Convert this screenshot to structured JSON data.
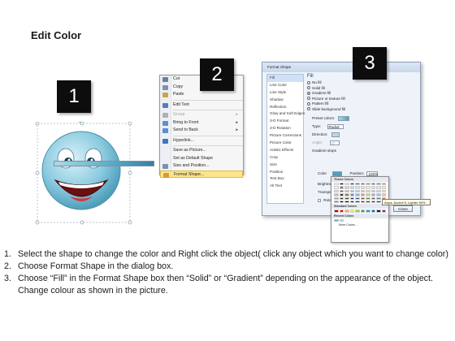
{
  "title": "Edit Color",
  "badges": [
    "1",
    "2",
    "3"
  ],
  "context_menu": {
    "items": [
      {
        "label": "Cut",
        "icon": "scissors-icon",
        "color": "#6a7fa6",
        "disabled": false
      },
      {
        "label": "Copy",
        "icon": "copy-icon",
        "color": "#7e8fb0",
        "disabled": false
      },
      {
        "label": "Paste",
        "icon": "paste-icon",
        "color": "#c9a44a",
        "disabled": false
      },
      {
        "label": "Edit Text",
        "icon": "edit-text-icon",
        "color": "#5b7bb4",
        "disabled": false,
        "sep_before": true
      },
      {
        "label": "Group",
        "icon": "group-icon",
        "color": "#b0b0b0",
        "disabled": true,
        "sep_before": true,
        "submenu": true
      },
      {
        "label": "Bring to Front",
        "icon": "bring-front-icon",
        "color": "#5a8fd0",
        "disabled": false,
        "submenu": true
      },
      {
        "label": "Send to Back",
        "icon": "send-back-icon",
        "color": "#5a8fd0",
        "disabled": false,
        "submenu": true
      },
      {
        "label": "Hyperlink...",
        "icon": "hyperlink-icon",
        "color": "#3f74c4",
        "disabled": false,
        "sep_before": true
      },
      {
        "label": "Save as Picture...",
        "icon": "",
        "color": "",
        "disabled": false,
        "sep_before": true
      },
      {
        "label": "Set as Default Shape",
        "icon": "",
        "color": "",
        "disabled": false
      },
      {
        "label": "Size and Position...",
        "icon": "size-icon",
        "color": "#7b8fb1",
        "disabled": false
      },
      {
        "label": "Format Shape...",
        "icon": "format-shape-icon",
        "color": "#d59b3a",
        "disabled": false,
        "highlight": true
      }
    ]
  },
  "dialog": {
    "title": "Format Shape",
    "categories": [
      "Fill",
      "Line Color",
      "Line Style",
      "Shadow",
      "Reflection",
      "Glow and Soft Edges",
      "3-D Format",
      "3-D Rotation",
      "Picture Corrections",
      "Picture Color",
      "Artistic Effects",
      "Crop",
      "Size",
      "Position",
      "Text Box",
      "Alt Text"
    ],
    "selected_category": "Fill",
    "section_title": "Fill",
    "fill_options": [
      "No fill",
      "Solid fill",
      "Gradient fill",
      "Picture or texture fill",
      "Pattern fill",
      "Slide background fill"
    ],
    "selected_fill": "Gradient fill",
    "preset_label": "Preset colors:",
    "type_label": "Type:",
    "type_value": "Radial",
    "direction_label": "Direction:",
    "angle_label": "Angle:",
    "angle_value": "0°",
    "stops_label": "Gradient stops",
    "color_label": "Color",
    "position_label": "Position:",
    "position_value": "100%",
    "brightness_label": "Brightness:",
    "transparency_label": "Transparency:",
    "rotate_label": "Rotate with shape",
    "close_label": "Close"
  },
  "palette": {
    "theme_title": "Theme Colors",
    "standard_title": "Standard Colors",
    "recent_title": "Recent Colors",
    "more_label": "More Colors...",
    "tooltip": "Aqua, Accent 5, Lighter 80%",
    "theme_colors": [
      "#ffffff",
      "#000000",
      "#eeece1",
      "#1f497d",
      "#4f81bd",
      "#c0504d",
      "#9bbb59",
      "#8064a2",
      "#4bacc6",
      "#f79646",
      "#f2f2f2",
      "#7f7f7f",
      "#ddd9c3",
      "#c6d9f0",
      "#dbe5f1",
      "#f2dcdb",
      "#ebf1dd",
      "#e5e0ec",
      "#dbeef3",
      "#fdeada",
      "#d8d8d8",
      "#595959",
      "#c4bd97",
      "#8db3e2",
      "#b8cce4",
      "#e5b9b7",
      "#d7e3bc",
      "#ccc1d9",
      "#b7dde8",
      "#fbd5b5",
      "#bfbfbf",
      "#3f3f3f",
      "#938953",
      "#548dd4",
      "#95b3d7",
      "#d99694",
      "#c3d69b",
      "#b2a2c7",
      "#92cddc",
      "#fac08f",
      "#a5a5a5",
      "#262626",
      "#494429",
      "#17365d",
      "#366092",
      "#953734",
      "#76923c",
      "#5f497a",
      "#31859b",
      "#e36c09",
      "#7f7f7f",
      "#0c0c0c",
      "#1d1b10",
      "#0f243e",
      "#244061",
      "#632423",
      "#4f6128",
      "#3f3151",
      "#205867",
      "#974806"
    ],
    "standard_colors": [
      "#c00000",
      "#ff0000",
      "#ffc000",
      "#ffff00",
      "#92d050",
      "#00b050",
      "#00b0f0",
      "#0070c0",
      "#002060",
      "#7030a0"
    ],
    "recent_colors": [
      "#4f9fbb",
      "#a9dbe5"
    ]
  },
  "steps": [
    {
      "num": "1.",
      "text": "Select the shape to change the color and Right click the object( click any object which you want to change color)"
    },
    {
      "num": "2.",
      "text": "Choose Format Shape in the dialog box."
    },
    {
      "num": "3.",
      "text": "Choose “Fill” in the Format Shape box then “Solid” or “Gradient” depending on the appearance of the object. Change colour as shown in the picture."
    }
  ]
}
